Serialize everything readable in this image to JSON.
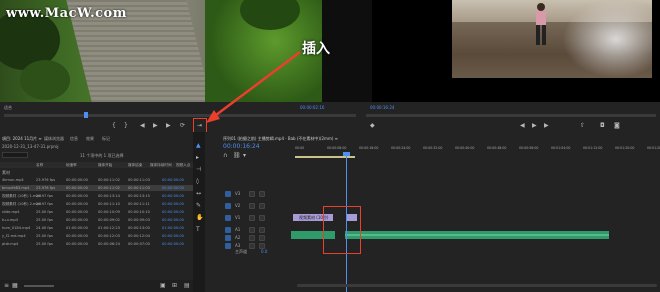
{
  "watermark": "www.MacW.com",
  "annotation": {
    "label": "插入",
    "color": "#e8402c"
  },
  "source_monitor": {
    "timecode_right": "00:00:02:16",
    "scrub_label": "适合"
  },
  "program_monitor": {
    "timecode_left": "00:00:16:24",
    "timecode_right": "00:00:32:16",
    "fit_label": "适合"
  },
  "project_panel": {
    "title": "項目: 2024 11月片 ≡",
    "tabs": [
      "媒体浏览器",
      "信息",
      "效果",
      "标记"
    ],
    "file_name": "2020-12-31_13-47-31.prproj",
    "item_count": "11 个项中的 1 项已选择",
    "columns": [
      "名称",
      "帧速率",
      "媒体开始",
      "媒体结束",
      "媒体持续时间",
      "视频入点"
    ],
    "bin_label": "素材",
    "rows": [
      {
        "name": "4kmun.mp4",
        "fps": "23.976 fps",
        "start": "00:00:00:00",
        "end": "00:00:11:02",
        "dur": "00:00:11:03",
        "in": "00:00:00:00"
      },
      {
        "name": "bmuvfe83.mp4",
        "fps": "23.976 fps",
        "start": "00:00:00:00",
        "end": "00:00:11:02",
        "dur": "00:00:11:03",
        "in": "00:00:00:00"
      },
      {
        "name": "视频素材 (10秒) 1.mp4",
        "fps": "29.97 fps",
        "start": "00:00:00:00",
        "end": "00:00:13:14",
        "dur": "00:00:13:15",
        "in": "00:00:00:00"
      },
      {
        "name": "视频素材 (10秒) 2.mp4",
        "fps": "29.97 fps",
        "start": "00:00:00:00",
        "end": "00:00:11:10",
        "dur": "00:00:11:11",
        "in": "00:00:00:00"
      },
      {
        "name": "slide.mp4",
        "fps": "25.00 fps",
        "start": "00:00:00:00",
        "end": "00:00:10:09",
        "dur": "00:00:10:10",
        "in": "00:00:00:00"
      },
      {
        "name": "tu-v.mp4",
        "fps": "25.00 fps",
        "start": "00:00:00:00",
        "end": "00:00:09:02",
        "dur": "00:00:09:03",
        "in": "00:00:00:00"
      },
      {
        "name": "hum_0184.mp4",
        "fps": "24.00 fps",
        "start": "01:00:00:00",
        "end": "01:00:12:23",
        "dur": "00:00:13:00",
        "in": "01:00:00:00"
      },
      {
        "name": "y_f2.md.mp4",
        "fps": "25.00 fps",
        "start": "00:00:00:00",
        "end": "00:00:12:03",
        "dur": "00:00:12:04",
        "in": "00:00:00:00"
      },
      {
        "name": "ptdr.mp4",
        "fps": "25.00 fps",
        "start": "00:00:00:00",
        "end": "00:00:06:24",
        "dur": "00:00:07:00",
        "in": "00:00:00:00"
      }
    ]
  },
  "timeline": {
    "sequence_tab": "序列01 (拍摄之前) 主播剪辑.mp4 · Bab (不在素材中)(2mm) ≡",
    "current_time": "00:00:16:24",
    "ruler_ticks": [
      "00:00",
      "00:00:08:00",
      "00:00:16:00",
      "00:00:24:00",
      "00:00:32:00",
      "00:00:40:00",
      "00:00:48:00",
      "00:00:56:00",
      "00:01:04:00",
      "00:01:12:00",
      "00:01:20:00",
      "00:01:28:00"
    ],
    "tracks_video": [
      "V3",
      "V2",
      "V1"
    ],
    "tracks_audio": [
      "A1",
      "A2",
      "A3"
    ],
    "master_label": "主声道",
    "master_value": "0.0",
    "clip_label": "视频素材 (10秒)"
  },
  "colors": {
    "accent_blue": "#4f8ff0",
    "clip_video": "#a79ad6",
    "clip_audio": "#2f9a6a",
    "highlight_box": "#e8402c"
  }
}
